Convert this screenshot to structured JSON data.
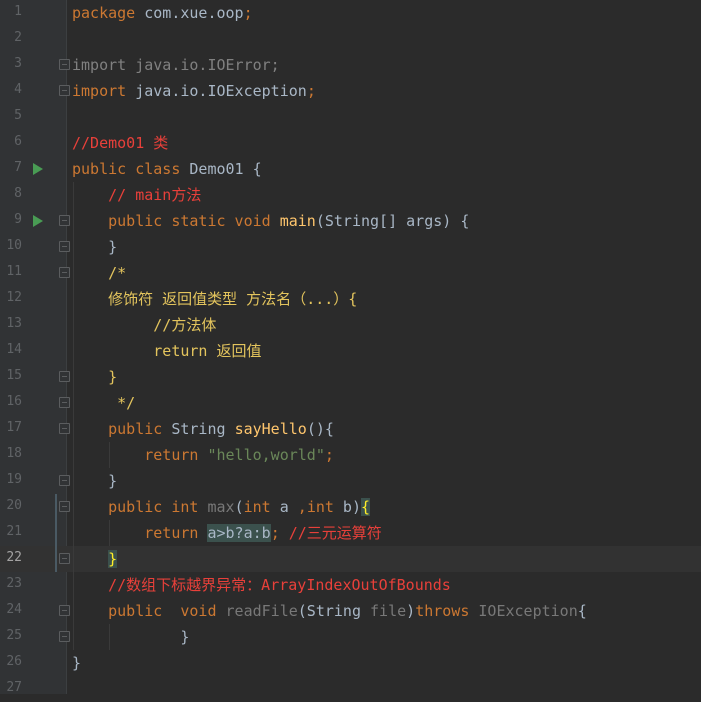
{
  "editor": {
    "current_line": 22,
    "lines": [
      {
        "n": "1",
        "segs": [
          {
            "c": "k",
            "t": "package"
          },
          {
            "t": " com.xue.oop"
          },
          {
            "c": "k",
            "t": ";"
          }
        ]
      },
      {
        "n": "2",
        "segs": []
      },
      {
        "n": "3",
        "fold": true,
        "segs": [
          {
            "c": "g",
            "t": "import java.io.IOError;"
          }
        ]
      },
      {
        "n": "4",
        "fold": true,
        "segs": [
          {
            "c": "k",
            "t": "import"
          },
          {
            "t": " java.io.IOException"
          },
          {
            "c": "k",
            "t": ";"
          }
        ]
      },
      {
        "n": "5",
        "segs": []
      },
      {
        "n": "6",
        "segs": [
          {
            "c": "c",
            "t": "//Demo01 类"
          }
        ]
      },
      {
        "n": "7",
        "run": true,
        "segs": [
          {
            "c": "k",
            "t": "public class"
          },
          {
            "t": " Demo01 {"
          }
        ]
      },
      {
        "n": "8",
        "segs": [
          {
            "t": "    "
          },
          {
            "c": "c",
            "t": "// main方法"
          }
        ]
      },
      {
        "n": "9",
        "run": true,
        "fold": true,
        "segs": [
          {
            "t": "    "
          },
          {
            "c": "k",
            "t": "public static void"
          },
          {
            "t": " "
          },
          {
            "c": "f",
            "t": "main"
          },
          {
            "t": "(String[] args) {"
          }
        ]
      },
      {
        "n": "10",
        "fold": true,
        "segs": [
          {
            "t": "    }"
          }
        ]
      },
      {
        "n": "11",
        "fold": true,
        "segs": [
          {
            "t": "    "
          },
          {
            "c": "y",
            "t": "/*"
          }
        ]
      },
      {
        "n": "12",
        "segs": [
          {
            "t": "    "
          },
          {
            "c": "y",
            "t": "修饰符 返回值类型 方法名（...）{"
          }
        ]
      },
      {
        "n": "13",
        "segs": [
          {
            "t": "         "
          },
          {
            "c": "y",
            "t": "//方法体"
          }
        ]
      },
      {
        "n": "14",
        "segs": [
          {
            "t": "         "
          },
          {
            "c": "y",
            "t": "return 返回值"
          }
        ]
      },
      {
        "n": "15",
        "fold": true,
        "segs": [
          {
            "t": "    "
          },
          {
            "c": "y",
            "t": "}"
          }
        ]
      },
      {
        "n": "16",
        "fold": true,
        "segs": [
          {
            "t": "     "
          },
          {
            "c": "y",
            "t": "*/"
          }
        ]
      },
      {
        "n": "17",
        "fold": true,
        "segs": [
          {
            "t": "    "
          },
          {
            "c": "k",
            "t": "public"
          },
          {
            "t": " String "
          },
          {
            "c": "f",
            "t": "sayHello"
          },
          {
            "t": "(){"
          }
        ]
      },
      {
        "n": "18",
        "segs": [
          {
            "t": "        "
          },
          {
            "c": "k",
            "t": "return"
          },
          {
            "t": " "
          },
          {
            "c": "s",
            "t": "\"hello,world\""
          },
          {
            "c": "k",
            "t": ";"
          }
        ]
      },
      {
        "n": "19",
        "fold": true,
        "segs": [
          {
            "t": "    }"
          }
        ]
      },
      {
        "n": "20",
        "fold": true,
        "segs": [
          {
            "t": "    "
          },
          {
            "c": "k",
            "t": "public int"
          },
          {
            "t": " "
          },
          {
            "c": "dim",
            "t": "max"
          },
          {
            "t": "("
          },
          {
            "c": "k",
            "t": "int"
          },
          {
            "t": " a "
          },
          {
            "c": "k",
            "t": ","
          },
          {
            "c": "k",
            "t": "int"
          },
          {
            "t": " b)"
          },
          {
            "c": "brace",
            "t": "{"
          }
        ]
      },
      {
        "n": "21",
        "segs": [
          {
            "t": "        "
          },
          {
            "c": "k",
            "t": "return"
          },
          {
            "t": " "
          },
          {
            "c": "hl",
            "t": "a>b?a:b"
          },
          {
            "c": "k",
            "t": ";"
          },
          {
            "t": " "
          },
          {
            "c": "c",
            "t": "//三元运算符"
          }
        ]
      },
      {
        "n": "22",
        "fold": true,
        "segs": [
          {
            "t": "    "
          },
          {
            "c": "brace",
            "t": "}"
          }
        ]
      },
      {
        "n": "23",
        "segs": [
          {
            "t": "    "
          },
          {
            "c": "c",
            "t": "//数组下标越界异常：ArrayIndexOutOfBounds"
          }
        ]
      },
      {
        "n": "24",
        "fold": true,
        "segs": [
          {
            "t": "    "
          },
          {
            "c": "k",
            "t": "public"
          },
          {
            "t": "  "
          },
          {
            "c": "k",
            "t": "void"
          },
          {
            "t": " "
          },
          {
            "c": "dim",
            "t": "readFile"
          },
          {
            "t": "(String "
          },
          {
            "c": "dim",
            "t": "file"
          },
          {
            "t": ")"
          },
          {
            "c": "k",
            "t": "throws"
          },
          {
            "t": " "
          },
          {
            "c": "dim",
            "t": "IOException"
          },
          {
            "t": "{"
          }
        ]
      },
      {
        "n": "25",
        "fold": true,
        "segs": [
          {
            "t": "            }"
          }
        ]
      },
      {
        "n": "26",
        "segs": [
          {
            "t": "}"
          }
        ]
      },
      {
        "n": "27",
        "segs": []
      }
    ]
  }
}
